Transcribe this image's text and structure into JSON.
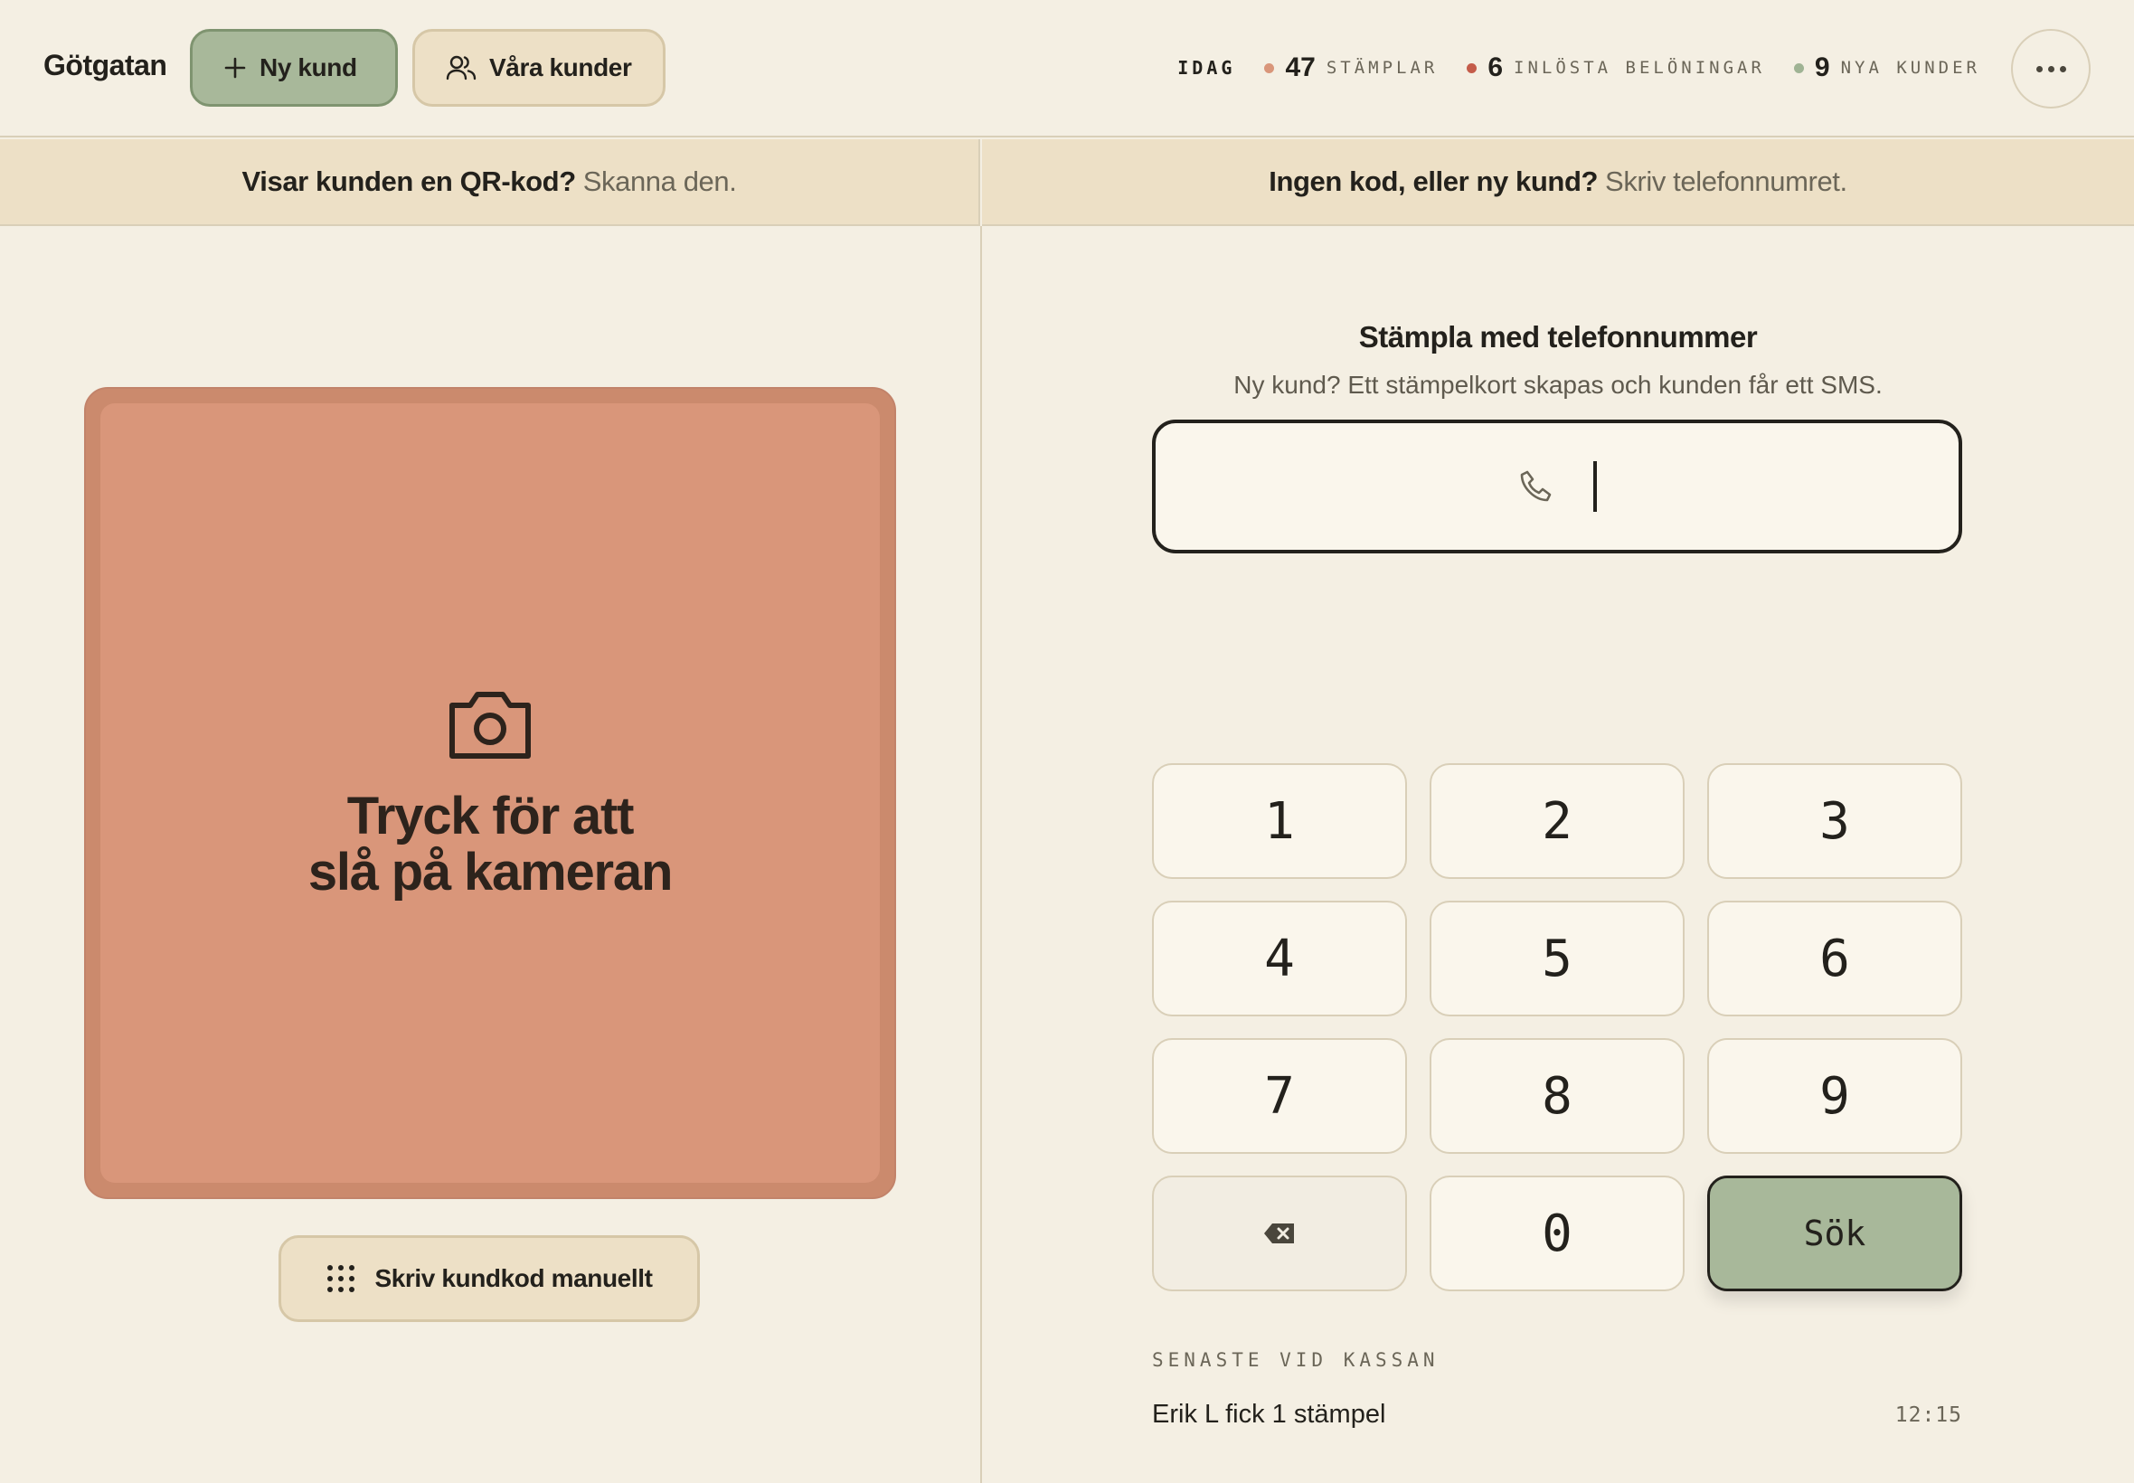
{
  "header": {
    "store_name": "Götgatan",
    "new_customer_label": "Ny kund",
    "customers_label": "Våra kunder",
    "today_label": "IDAG",
    "stats": [
      {
        "value": "47",
        "label": "STÄMPLAR",
        "color": "#d9967a"
      },
      {
        "value": "6",
        "label": "INLÖSTA BELÖNINGAR",
        "color": "#c45c4a"
      },
      {
        "value": "9",
        "label": "NYA KUNDER",
        "color": "#9fb394"
      }
    ],
    "more_icon": "more-dots-icon"
  },
  "banner_left": {
    "strong": "Visar kunden en QR-kod?",
    "muted": "Skanna den."
  },
  "banner_right": {
    "strong": "Ingen kod, eller ny kund?",
    "muted": "Skriv telefonnumret."
  },
  "camera": {
    "text": "Tryck för att\nslå på kameran",
    "icon": "camera-icon"
  },
  "manual_code_label": "Skriv kundkod manuellt",
  "phone": {
    "title": "Stämpla med telefonnummer",
    "subtitle": "Ny kund? Ett stämpelkort skapas och kunden får ett SMS.",
    "value": "",
    "icon": "phone-icon"
  },
  "keypad": {
    "keys": [
      "1",
      "2",
      "3",
      "4",
      "5",
      "6",
      "7",
      "8",
      "9",
      "⌫",
      "0",
      "Sök"
    ]
  },
  "recent": {
    "label": "SENASTE VID KASSAN",
    "items": [
      {
        "text": "Erik L fick 1 stämpel",
        "time": "12:15"
      }
    ]
  },
  "colors": {
    "background": "#f4efe3",
    "accent_green": "#a8b89a",
    "camera_terracotta": "#d9967a",
    "banner": "#ede0c6"
  }
}
